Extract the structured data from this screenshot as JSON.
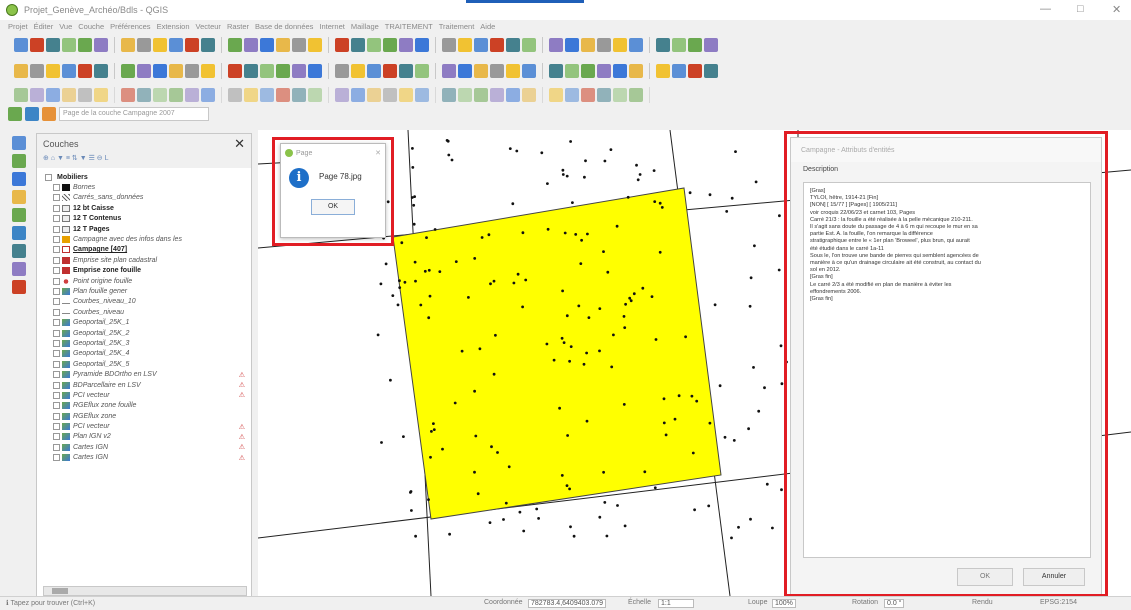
{
  "window": {
    "title": "Projet_Genève_Archéo/Bdls - QGIS",
    "controls": [
      "—",
      "□",
      "✕"
    ]
  },
  "menubar": [
    "Projet",
    "Éditer",
    "Vue",
    "Couche",
    "Préférences",
    "Extension",
    "Vecteur",
    "Raster",
    "Base de données",
    "Internet",
    "Maillage",
    "TRAITEMENT",
    "Traitement",
    "Aide"
  ],
  "search": {
    "placeholder": "Page de la couche Campagne 2007"
  },
  "layers_panel": {
    "title": "Couches",
    "tools": "⊕ ⌂ ▼ ≡ ⇅ ▼ ☰ ⊖ L",
    "close": "✕",
    "items": [
      {
        "label": "Mobiliers",
        "style": "bd",
        "sym": "group"
      },
      {
        "label": "Bornes",
        "style": "it",
        "sym": "#111111"
      },
      {
        "label": "Carrés_sans_données",
        "style": "it",
        "sym": "hatch"
      },
      {
        "label": "12 bt Caisse",
        "style": "bd",
        "sym": "table"
      },
      {
        "label": "12 T Contenus",
        "style": "bd",
        "sym": "table"
      },
      {
        "label": "12 T Pages",
        "style": "bd",
        "sym": "table"
      },
      {
        "label": "Campagne avec des infos dans les",
        "style": "it",
        "sym": "#e8a000"
      },
      {
        "label": "Campagne [407]",
        "style": "bd-under",
        "sym": "outline"
      },
      {
        "label": "Emprise site plan cadastral",
        "style": "it",
        "sym": "#c03030"
      },
      {
        "label": "Emprise zone fouille",
        "style": "bd",
        "sym": "#c03030"
      },
      {
        "label": "Point origine fouille",
        "style": "it",
        "sym": "dot"
      },
      {
        "label": "Plan fouille gener",
        "style": "it",
        "sym": "raster"
      },
      {
        "label": "Courbes_niveau_10",
        "style": "it",
        "sym": "line"
      },
      {
        "label": "Courbes_niveau",
        "style": "it",
        "sym": "line"
      },
      {
        "label": "Geoportail_25K_1",
        "style": "it",
        "sym": "raster"
      },
      {
        "label": "Geoportail_25K_2",
        "style": "it",
        "sym": "raster"
      },
      {
        "label": "Geoportail_25K_3",
        "style": "it",
        "sym": "raster"
      },
      {
        "label": "Geoportail_25K_4",
        "style": "it",
        "sym": "raster"
      },
      {
        "label": "Geoportail_25K_5",
        "style": "it",
        "sym": "raster"
      },
      {
        "label": "Pyramide BDOrtho en LSV",
        "style": "it",
        "sym": "raster",
        "warn": true
      },
      {
        "label": "BDParcellaire en LSV",
        "style": "it",
        "sym": "raster",
        "warn": true
      },
      {
        "label": "PCI vecteur",
        "style": "it",
        "sym": "raster",
        "warn": true
      },
      {
        "label": "RGEflux zone fouille",
        "style": "it",
        "sym": "raster"
      },
      {
        "label": "RGEflux zone",
        "style": "it",
        "sym": "raster"
      },
      {
        "label": "PCI vecteur",
        "style": "it",
        "sym": "raster",
        "warn": true
      },
      {
        "label": "Plan IGN v2",
        "style": "it",
        "sym": "raster",
        "warn": true
      },
      {
        "label": "Cartes IGN",
        "style": "it",
        "sym": "raster",
        "warn": true
      },
      {
        "label": "Cartes IGN",
        "style": "it",
        "sym": "raster",
        "warn": true
      }
    ]
  },
  "dialog": {
    "title": "Page",
    "close": "✕",
    "message": "Page 78.jpg",
    "ok": "OK"
  },
  "attribute_form": {
    "title": "Campagne - Attributs d'entités",
    "section": "Description",
    "text_lines": [
      "[Gras]",
      "TYLOI, hêtre, 1914-21 [Fin]",
      "[NON] [ 15/77 ] [Pages] [ 1905/211]",
      "voir croquis 22/06/23 et carnet 103, Pages",
      "Carré 21/3 : la fouille a été réalisée à la pelle mécanique 210-211.",
      "Il s'agit sans doute du passage de 4 à 6 m qui recoupe le mur en sa",
      "partie Est. A. la fouille, l'on remarque la différence",
      "stratigraphique entre le « 1er plan 'Broweel', plus brun, qui aurait",
      "été étudié dans le carré 1a-11",
      "Sous le, l'on trouve une bande de pierres qui semblent agencées de",
      "manière à ce qu'un drainage circulaire ait été construit, au contact du",
      "sol en 2012.",
      "[Gras fin]",
      "Le carré 2/3 a été modifié en plan de manière à éviter les",
      "effondrements 2006.",
      "[Gras fin]"
    ],
    "ok": "OK",
    "cancel": "Annuler"
  },
  "status": {
    "left": "ℹ Tapez pour trouver (Ctrl+K)",
    "coord_label": "Coordonnée",
    "coord": "782783.4,6409403.079",
    "scale_label": "Échelle",
    "scale": "1:1",
    "magnifier_label": "Loupe",
    "magnifier": "100%",
    "rotation_label": "Rotation",
    "rotation": "0.0 °",
    "render": "Rendu",
    "crs": "EPSG:2154"
  },
  "toolbar_rows": [
    46,
    46,
    42
  ],
  "colors": {
    "highlight": "#e11d24",
    "polygon": "#ffff00",
    "accent": "#1e6fc8"
  }
}
